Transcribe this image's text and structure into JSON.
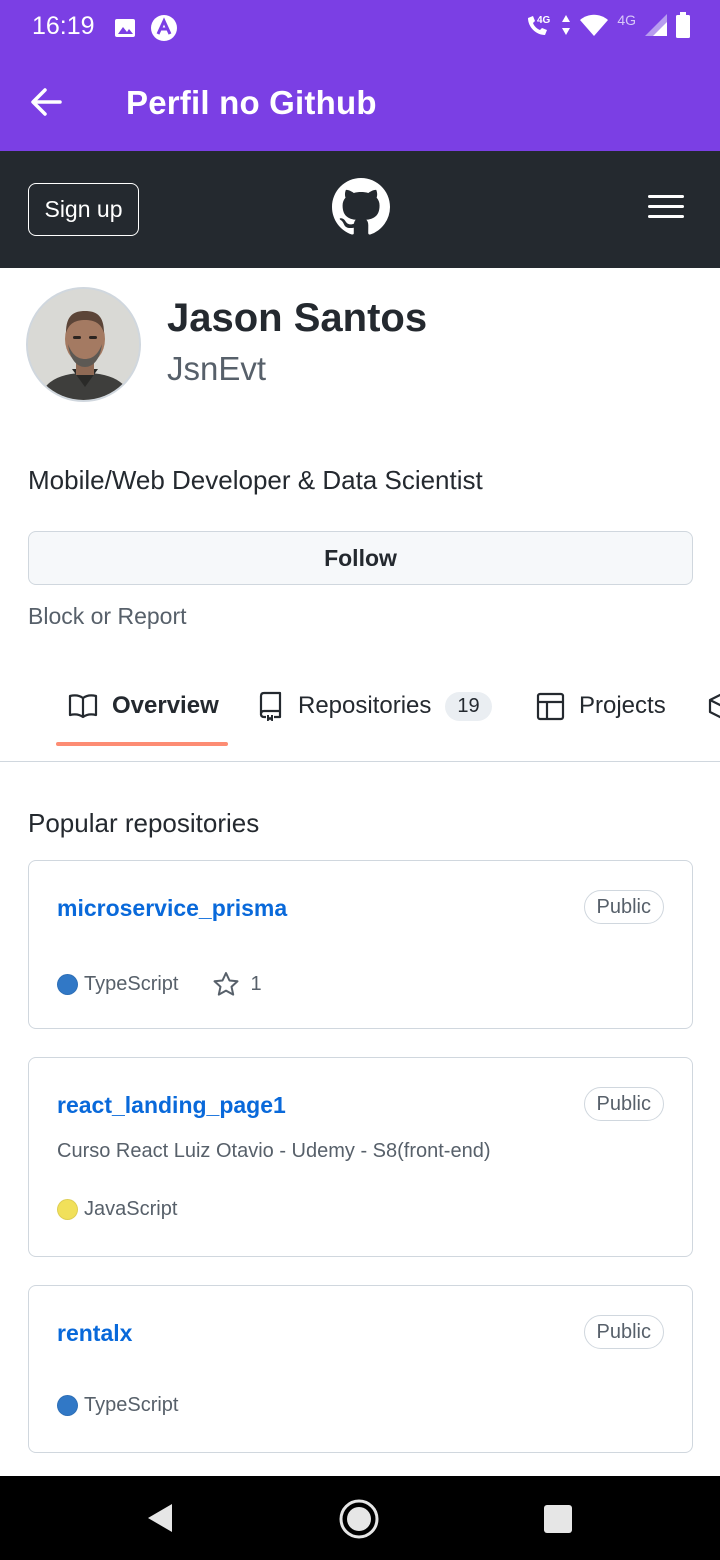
{
  "status_bar": {
    "time": "16:19",
    "network_label": "4G",
    "icons": [
      "gallery-icon",
      "app-icon",
      "call-4g-icon",
      "data-arrows-icon",
      "wifi-icon",
      "signal-icon",
      "battery-icon"
    ]
  },
  "app_bar": {
    "title": "Perfil no Github",
    "back_icon": "arrow-back-icon"
  },
  "gh_header": {
    "signup_label": "Sign up",
    "logo_icon": "github-logo-icon",
    "menu_icon": "hamburger-menu-icon"
  },
  "profile": {
    "display_name": "Jason Santos",
    "username": "JsnEvt",
    "bio": "Mobile/Web Developer & Data Scientist",
    "follow_label": "Follow",
    "block_label": "Block or Report"
  },
  "tabs": [
    {
      "label": "Overview",
      "icon": "book-icon",
      "active": true
    },
    {
      "label": "Repositories",
      "icon": "repo-icon",
      "counter": "19"
    },
    {
      "label": "Projects",
      "icon": "table-icon"
    },
    {
      "label": "",
      "icon": "package-icon"
    }
  ],
  "popular": {
    "title": "Popular repositories",
    "repos": [
      {
        "name": "microservice_prisma",
        "badge": "Public",
        "description": "",
        "language": "TypeScript",
        "language_color": "#3178c6",
        "stars": "1"
      },
      {
        "name": "react_landing_page1",
        "badge": "Public",
        "description": "Curso React Luiz Otavio - Udemy - S8(front-end)",
        "language": "JavaScript",
        "language_color": "#f1e05a"
      },
      {
        "name": "rentalx",
        "badge": "Public",
        "description": "",
        "language": "TypeScript",
        "language_color": "#3178c6"
      }
    ]
  },
  "colors": {
    "accent": "#7b3fe4",
    "gh_header": "#24292f",
    "link": "#0969da",
    "tab_underline": "#fd8c73"
  },
  "nav_bar": {
    "icons": [
      "nav-back-icon",
      "nav-home-icon",
      "nav-recents-icon"
    ]
  }
}
